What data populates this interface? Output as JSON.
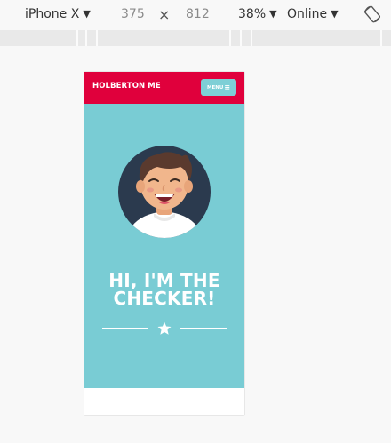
{
  "devtools": {
    "device": "iPhone X",
    "width": "375",
    "times": "×",
    "height": "812",
    "zoom": "38%",
    "network": "Online",
    "caret": "▼"
  },
  "site": {
    "brand": "HOLBERTON ME",
    "menu_label": "MENU",
    "menu_glyph": "≡",
    "hero_title_line1": "HI, I'M THE",
    "hero_title_line2": "CHECKER!"
  },
  "colors": {
    "header": "#e0003c",
    "hero_bg": "#79ccd4",
    "menu_button": "#7ecfd6",
    "avatar_circle": "#2b3a4e"
  },
  "icons": {
    "rotate": "rotate-icon",
    "star": "star-icon",
    "menu": "hamburger-icon"
  }
}
